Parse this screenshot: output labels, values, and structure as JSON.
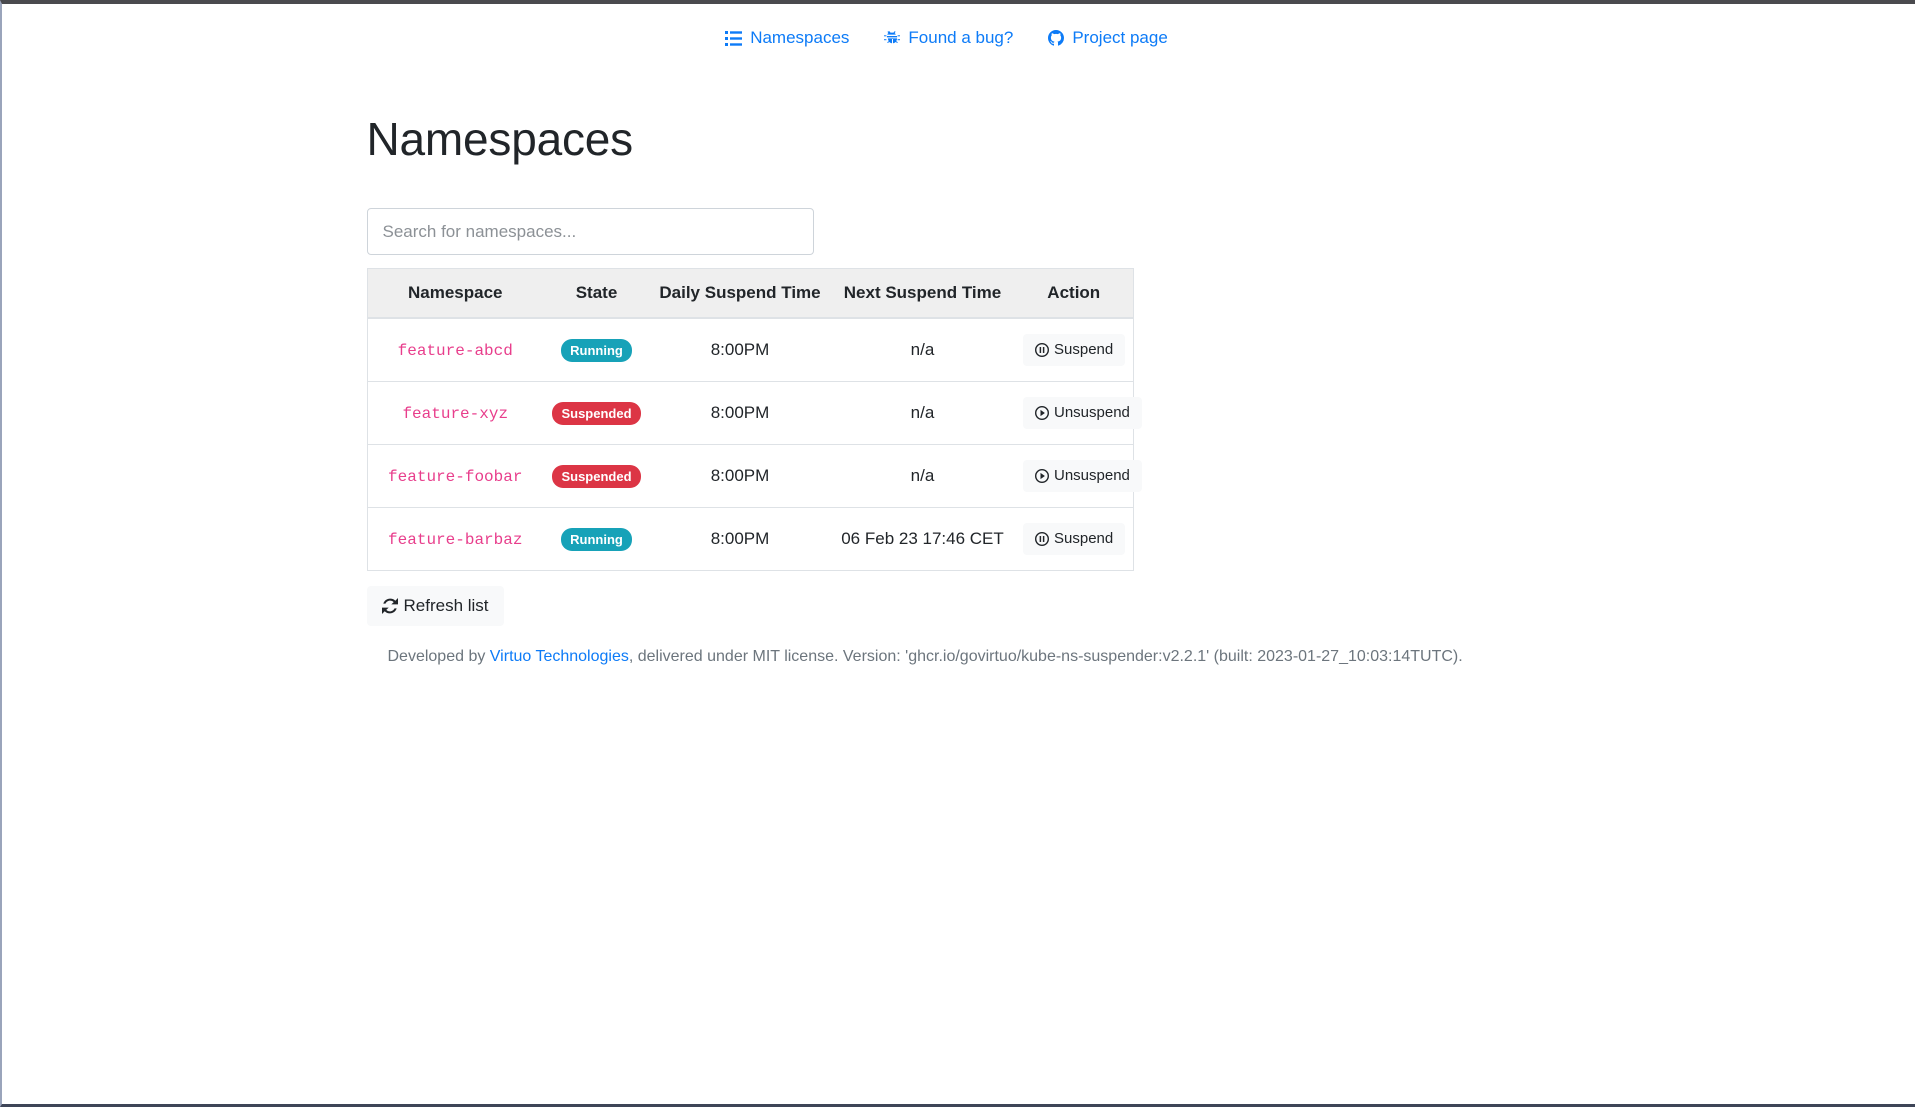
{
  "nav": {
    "items": [
      {
        "label": "Namespaces",
        "icon": "list-icon"
      },
      {
        "label": "Found a bug?",
        "icon": "bug-icon"
      },
      {
        "label": "Project page",
        "icon": "github-icon"
      }
    ]
  },
  "page": {
    "title": "Namespaces"
  },
  "search": {
    "placeholder": "Search for namespaces...",
    "value": ""
  },
  "table": {
    "headers": [
      "Namespace",
      "State",
      "Daily Suspend Time",
      "Next Suspend Time",
      "Action"
    ],
    "rows": [
      {
        "namespace": "feature-abcd",
        "state": "Running",
        "state_kind": "running",
        "daily_suspend_time": "8:00PM",
        "next_suspend_time": "n/a",
        "action_label": "Suspend",
        "action_icon": "pause-circle-icon"
      },
      {
        "namespace": "feature-xyz",
        "state": "Suspended",
        "state_kind": "suspended",
        "daily_suspend_time": "8:00PM",
        "next_suspend_time": "n/a",
        "action_label": "Unsuspend",
        "action_icon": "play-circle-icon"
      },
      {
        "namespace": "feature-foobar",
        "state": "Suspended",
        "state_kind": "suspended",
        "daily_suspend_time": "8:00PM",
        "next_suspend_time": "n/a",
        "action_label": "Unsuspend",
        "action_icon": "play-circle-icon"
      },
      {
        "namespace": "feature-barbaz",
        "state": "Running",
        "state_kind": "running",
        "daily_suspend_time": "8:00PM",
        "next_suspend_time": "06 Feb 23 17:46 CET",
        "action_label": "Suspend",
        "action_icon": "pause-circle-icon"
      }
    ]
  },
  "refresh": {
    "label": "Refresh list",
    "icon": "refresh-icon"
  },
  "footer": {
    "prefix": "Developed by ",
    "link_label": "Virtuo Technologies",
    "suffix": ", delivered under MIT license. Version: 'ghcr.io/govirtuo/kube-ns-suspender:v2.2.1' (built: 2023-01-27_10:03:14TUTC)."
  },
  "colors": {
    "link": "#0d7bf7",
    "running_badge": "#17a2b8",
    "suspended_badge": "#dc3545",
    "namespace_code": "#e83e8c",
    "table_head_bg": "#efefef",
    "muted_text": "#6c757d"
  }
}
